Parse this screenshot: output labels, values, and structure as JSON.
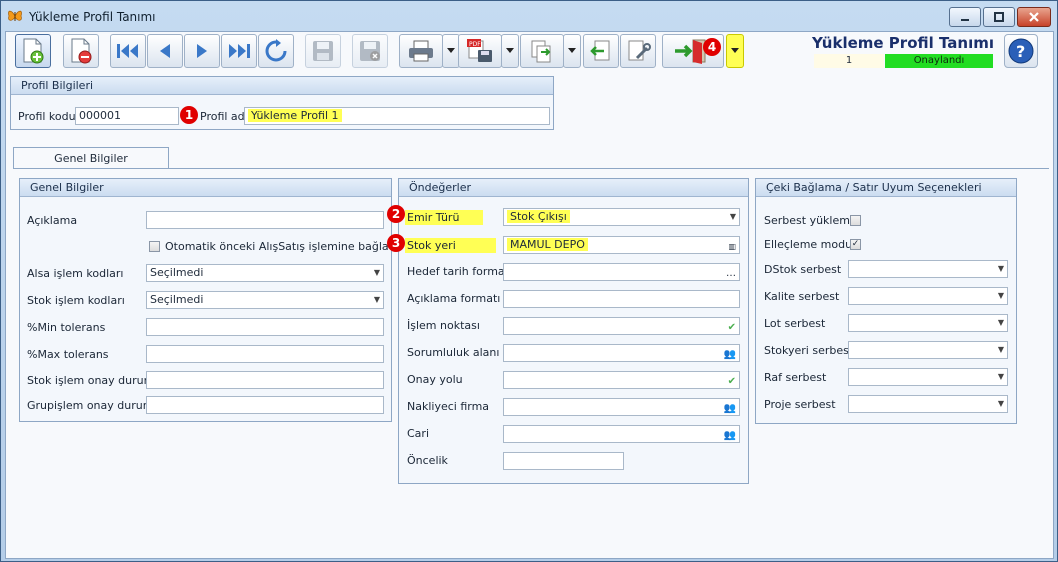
{
  "window": {
    "title": "Yükleme Profil Tanımı"
  },
  "header": {
    "title": "Yükleme Profil Tanımı",
    "record_number": "1",
    "status": "Onaylandı",
    "status_color": "#22dd22"
  },
  "toolbar": {
    "icons": [
      "new-document",
      "delete-document",
      "first-record",
      "previous-record",
      "next-record",
      "last-record",
      "refresh",
      "save",
      "save-cancel",
      "print",
      "pdf-export",
      "export",
      "import",
      "settings",
      "exit",
      "help"
    ]
  },
  "profil": {
    "group_title": "Profil Bilgileri",
    "kod_label": "Profil kodu",
    "kod_value": "000001",
    "adi_label": "Profil adı",
    "adi_value": "Yükleme Profil 1"
  },
  "tabs": [
    {
      "label": "Genel Bilgiler",
      "active": true
    }
  ],
  "genel": {
    "group_title": "Genel Bilgiler",
    "aciklama_label": "Açıklama",
    "aciklama_value": "",
    "otomatik_label": "Otomatik önceki AlışSatış işlemine bağla",
    "otomatik_checked": false,
    "alsa_label": "Alsa işlem kodları",
    "alsa_value": "Seçilmedi",
    "stok_label": "Stok işlem kodları",
    "stok_value": "Seçilmedi",
    "min_label": "%Min tolerans",
    "min_value": "",
    "max_label": "%Max tolerans",
    "max_value": "",
    "stok_onay_label": "Stok işlem onay durumu",
    "stok_onay_value": "",
    "grup_onay_label": "Grupişlem onay durumu",
    "grup_onay_value": ""
  },
  "ondegerler": {
    "group_title": "Öndeğerler",
    "emir_label": "Emir Türü",
    "emir_value": "Stok Çıkışı",
    "stokyeri_label": "Stok yeri",
    "stokyeri_value": "MAMUL DEPO",
    "hedef_label": "Hedef tarih formatı",
    "hedef_value": "",
    "aciklama_label": "Açıklama formatı",
    "aciklama_value": "",
    "islem_label": "İşlem noktası",
    "islem_value": "",
    "sorumluluk_label": "Sorumluluk alanı",
    "sorumluluk_value": "",
    "onay_label": "Onay yolu",
    "onay_value": "",
    "nakliyeci_label": "Nakliyeci firma",
    "nakliyeci_value": "",
    "cari_label": "Cari",
    "cari_value": "",
    "oncelik_label": "Öncelik",
    "oncelik_value": ""
  },
  "ceki": {
    "group_title": "Çeki Bağlama / Satır Uyum Seçenekleri",
    "serbest_label": "Serbest yükleme",
    "serbest_checked": false,
    "elle_label": "Elleçleme modu",
    "elle_checked": true,
    "dstok_label": "DStok serbest",
    "kalite_label": "Kalite serbest",
    "lot_label": "Lot serbest",
    "stokyeri_label": "Stokyeri serbest",
    "raf_label": "Raf serbest",
    "proje_label": "Proje serbest"
  },
  "badges": [
    "1",
    "2",
    "3",
    "4"
  ],
  "colors": {
    "highlight": "#ffff55",
    "badge": "#e00000",
    "accent": "#1a2f6b"
  }
}
